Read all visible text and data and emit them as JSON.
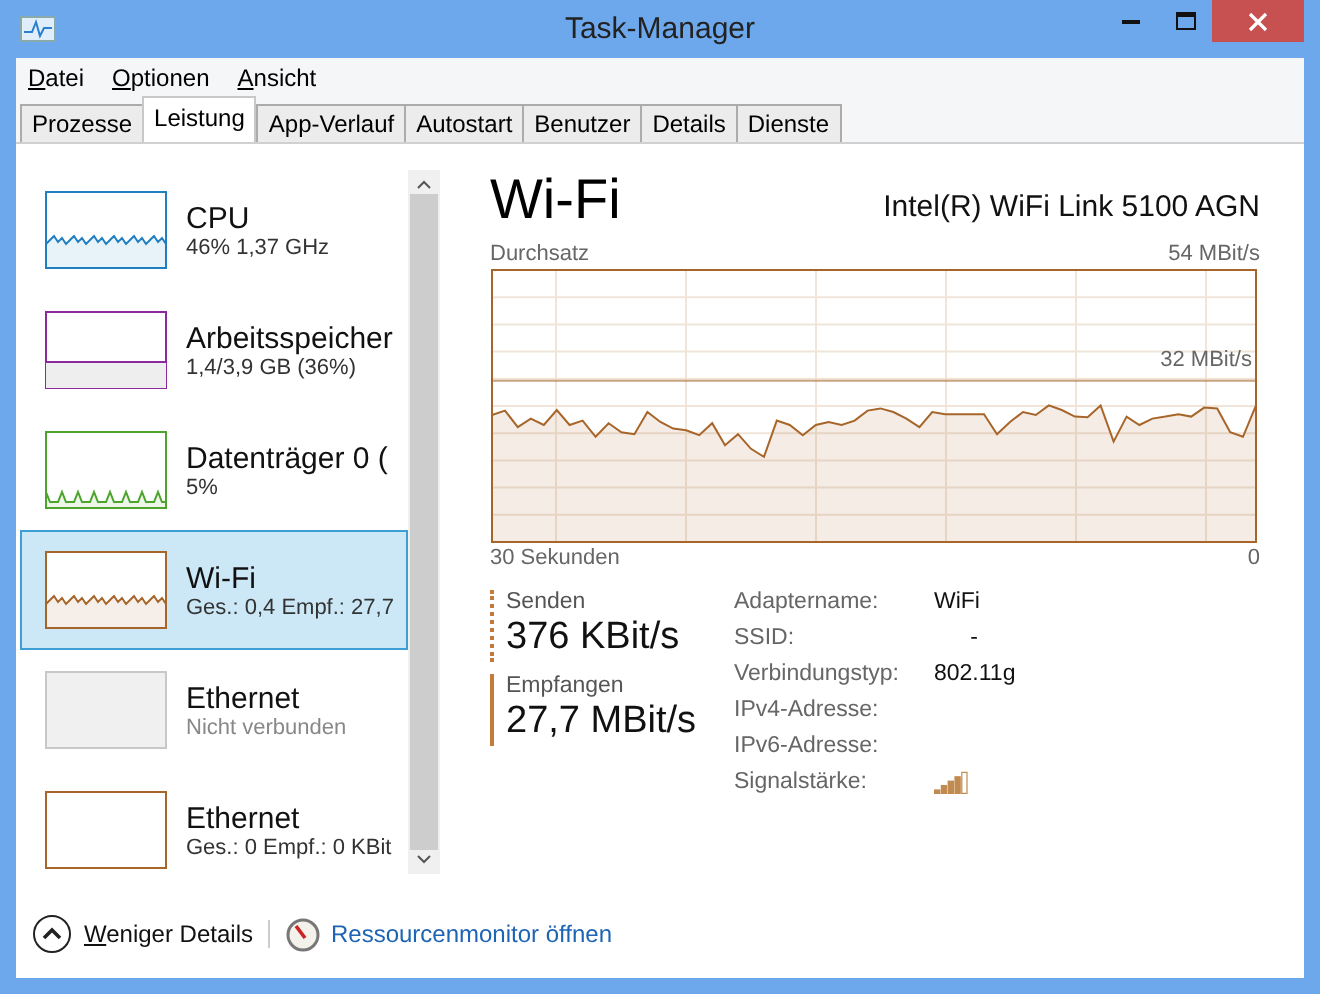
{
  "window": {
    "title": "Task-Manager"
  },
  "menu": [
    "Datei",
    "Optionen",
    "Ansicht"
  ],
  "tabs": [
    {
      "label": "Prozesse",
      "selected": false
    },
    {
      "label": "Leistung",
      "selected": true
    },
    {
      "label": "App-Verlauf",
      "selected": false
    },
    {
      "label": "Autostart",
      "selected": false
    },
    {
      "label": "Benutzer",
      "selected": false
    },
    {
      "label": "Details",
      "selected": false
    },
    {
      "label": "Dienste",
      "selected": false
    }
  ],
  "sidebar": {
    "items": [
      {
        "title": "CPU",
        "subtitle": "46%  1,37 GHz",
        "color": "#1f7fc0",
        "kind": "wave",
        "selected": false,
        "disabled": false
      },
      {
        "title": "Arbeitsspeicher",
        "subtitle": "1,4/3,9 GB (36%)",
        "color": "#8b2a9e",
        "kind": "fill",
        "selected": false,
        "disabled": false
      },
      {
        "title": "Datenträger 0 (",
        "subtitle": "5%",
        "color": "#4da42c",
        "kind": "spikes",
        "selected": false,
        "disabled": false
      },
      {
        "title": "Wi-Fi",
        "subtitle": "Ges.: 0,4 Empf.: 27,7",
        "color": "#a7652a",
        "kind": "wave",
        "selected": true,
        "disabled": false
      },
      {
        "title": "Ethernet",
        "subtitle": "Nicht verbunden",
        "color": "#c8c8c8",
        "kind": "empty",
        "selected": false,
        "disabled": true
      },
      {
        "title": "Ethernet",
        "subtitle": "Ges.: 0 Empf.: 0 KBit",
        "color": "#a7652a",
        "kind": "empty",
        "selected": false,
        "disabled": false
      }
    ]
  },
  "detail": {
    "title": "Wi-Fi",
    "device": "Intel(R) WiFi Link 5100 AGN",
    "graph": {
      "title": "Durchsatz",
      "max_label": "54 MBit/s",
      "ref_label": "32 MBit/s",
      "start_label": "30 Sekunden",
      "end_label": "0"
    },
    "stats": [
      {
        "label": "Senden",
        "value": "376 KBit/s",
        "kind": "dotted"
      },
      {
        "label": "Empfangen",
        "value": "27,7 MBit/s",
        "kind": "solid"
      }
    ],
    "properties": [
      {
        "label": "Adaptername:",
        "value": "WiFi",
        "kind": "text"
      },
      {
        "label": "SSID:",
        "value": "-",
        "kind": "text"
      },
      {
        "label": "Verbindungstyp:",
        "value": "802.11g",
        "kind": "text"
      },
      {
        "label": "IPv4-Adresse:",
        "kind": "text"
      },
      {
        "label": "IPv6-Adresse:",
        "kind": "text"
      },
      {
        "label": "Signalstärke:",
        "kind": "signal"
      }
    ]
  },
  "footer": {
    "details_button": "Weniger Details",
    "link": "Ressourcenmonitor öffnen"
  }
}
